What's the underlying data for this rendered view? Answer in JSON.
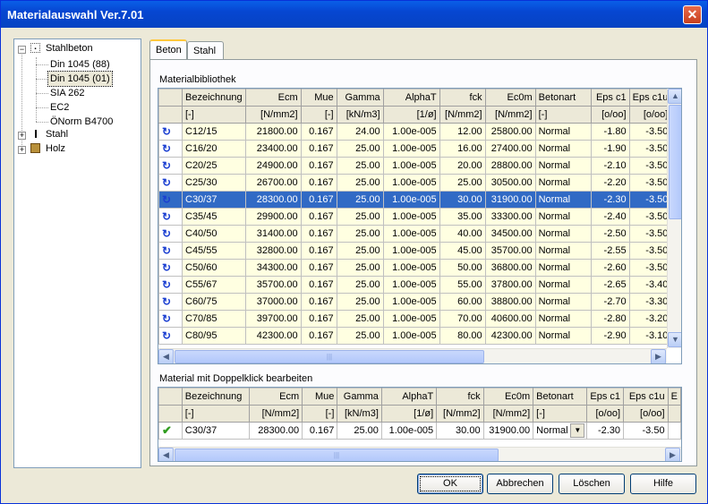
{
  "window": {
    "title": "Materialauswahl Ver.7.01",
    "close_label": "✕"
  },
  "tree": {
    "root": "Stahlbeton",
    "children": [
      "Din 1045 (88)",
      "Din 1045 (01)",
      "SIA 262",
      "EC2",
      "ÖNorm B4700"
    ],
    "selected": "Din 1045 (01)",
    "others": [
      "Stahl",
      "Holz"
    ]
  },
  "tabs": [
    "Beton",
    "Stahl"
  ],
  "library": {
    "label": "Materialbibliothek",
    "columns": [
      "",
      "Bezeichnung",
      "Ecm",
      "Mue",
      "Gamma",
      "AlphaT",
      "fck",
      "Ec0m",
      "Betonart",
      "Eps c1",
      "Eps c1u"
    ],
    "units": [
      "",
      "[-]",
      "[N/mm2]",
      "[-]",
      "[kN/m3]",
      "[1/ø]",
      "[N/mm2]",
      "[N/mm2]",
      "[-]",
      "[o/oo]",
      "[o/oo]"
    ],
    "rows": [
      [
        "C12/15",
        "21800.00",
        "0.167",
        "24.00",
        "1.00e-005",
        "12.00",
        "25800.00",
        "Normal",
        "-1.80",
        "-3.50"
      ],
      [
        "C16/20",
        "23400.00",
        "0.167",
        "25.00",
        "1.00e-005",
        "16.00",
        "27400.00",
        "Normal",
        "-1.90",
        "-3.50"
      ],
      [
        "C20/25",
        "24900.00",
        "0.167",
        "25.00",
        "1.00e-005",
        "20.00",
        "28800.00",
        "Normal",
        "-2.10",
        "-3.50"
      ],
      [
        "C25/30",
        "26700.00",
        "0.167",
        "25.00",
        "1.00e-005",
        "25.00",
        "30500.00",
        "Normal",
        "-2.20",
        "-3.50"
      ],
      [
        "C30/37",
        "28300.00",
        "0.167",
        "25.00",
        "1.00e-005",
        "30.00",
        "31900.00",
        "Normal",
        "-2.30",
        "-3.50"
      ],
      [
        "C35/45",
        "29900.00",
        "0.167",
        "25.00",
        "1.00e-005",
        "35.00",
        "33300.00",
        "Normal",
        "-2.40",
        "-3.50"
      ],
      [
        "C40/50",
        "31400.00",
        "0.167",
        "25.00",
        "1.00e-005",
        "40.00",
        "34500.00",
        "Normal",
        "-2.50",
        "-3.50"
      ],
      [
        "C45/55",
        "32800.00",
        "0.167",
        "25.00",
        "1.00e-005",
        "45.00",
        "35700.00",
        "Normal",
        "-2.55",
        "-3.50"
      ],
      [
        "C50/60",
        "34300.00",
        "0.167",
        "25.00",
        "1.00e-005",
        "50.00",
        "36800.00",
        "Normal",
        "-2.60",
        "-3.50"
      ],
      [
        "C55/67",
        "35700.00",
        "0.167",
        "25.00",
        "1.00e-005",
        "55.00",
        "37800.00",
        "Normal",
        "-2.65",
        "-3.40"
      ],
      [
        "C60/75",
        "37000.00",
        "0.167",
        "25.00",
        "1.00e-005",
        "60.00",
        "38800.00",
        "Normal",
        "-2.70",
        "-3.30"
      ],
      [
        "C70/85",
        "39700.00",
        "0.167",
        "25.00",
        "1.00e-005",
        "70.00",
        "40600.00",
        "Normal",
        "-2.80",
        "-3.20"
      ],
      [
        "C80/95",
        "42300.00",
        "0.167",
        "25.00",
        "1.00e-005",
        "80.00",
        "42300.00",
        "Normal",
        "-2.90",
        "-3.10"
      ]
    ],
    "selected_row": 4,
    "row_icon": "refresh-icon"
  },
  "editor": {
    "label": "Material mit Doppelklick bearbeiten",
    "columns": [
      "",
      "Bezeichnung",
      "Ecm",
      "Mue",
      "Gamma",
      "AlphaT",
      "fck",
      "Ec0m",
      "Betonart",
      "Eps c1",
      "Eps c1u",
      "E"
    ],
    "units": [
      "",
      "[-]",
      "[N/mm2]",
      "[-]",
      "[kN/m3]",
      "[1/ø]",
      "[N/mm2]",
      "[N/mm2]",
      "[-]",
      "[o/oo]",
      "[o/oo]",
      ""
    ],
    "row": [
      "C30/37",
      "28300.00",
      "0.167",
      "25.00",
      "1.00e-005",
      "30.00",
      "31900.00",
      "Normal",
      "-2.30",
      "-3.50"
    ],
    "row_icon": "check-icon"
  },
  "buttons": {
    "ok": "OK",
    "cancel": "Abbrechen",
    "delete": "Löschen",
    "help": "Hilfe"
  },
  "colors": {
    "selection": "#316ac5",
    "row_bg": "#ffffe1",
    "titlebar": "#0a5fe8"
  }
}
